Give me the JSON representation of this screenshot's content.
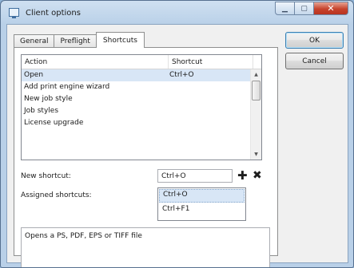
{
  "window": {
    "title": "Client options",
    "close_glyph": "✕"
  },
  "tabs": [
    {
      "label": "General",
      "active": false
    },
    {
      "label": "Preflight",
      "active": false
    },
    {
      "label": "Shortcuts",
      "active": true
    }
  ],
  "list": {
    "columns": [
      "Action",
      "Shortcut"
    ],
    "rows": [
      {
        "action": "Open",
        "shortcut": "Ctrl+O",
        "selected": true
      },
      {
        "action": "Add print engine wizard",
        "shortcut": ""
      },
      {
        "action": "New job style",
        "shortcut": ""
      },
      {
        "action": "Job styles",
        "shortcut": ""
      },
      {
        "action": "License upgrade",
        "shortcut": ""
      },
      {
        "action": "",
        "shortcut": ""
      }
    ]
  },
  "new_shortcut": {
    "label": "New shortcut:",
    "value": "Ctrl+O"
  },
  "assigned": {
    "label": "Assigned shortcuts:",
    "items": [
      "Ctrl+O",
      "Ctrl+F1"
    ]
  },
  "description": "Opens a PS, PDF, EPS or TIFF file",
  "buttons": {
    "ok": "OK",
    "cancel": "Cancel"
  },
  "icons": {
    "add": "plus-icon",
    "remove": "x-icon"
  },
  "colors": {
    "selection": "#d8e6f6",
    "titlebar": "#b9d0e8",
    "close": "#c7432d"
  }
}
